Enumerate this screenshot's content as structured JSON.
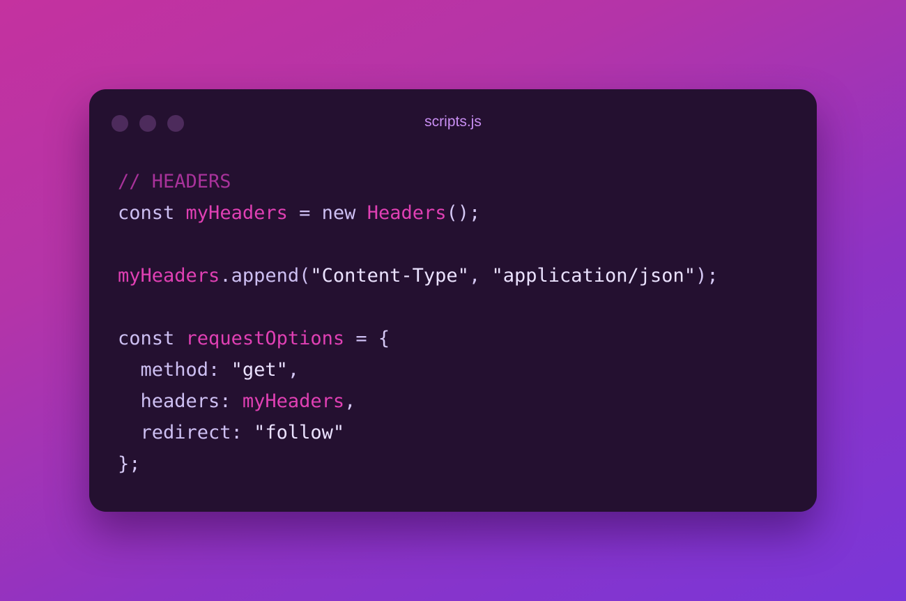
{
  "window": {
    "filename": "scripts.js"
  },
  "code": {
    "comment": "// HEADERS",
    "l2": {
      "kw": "const",
      "var": "myHeaders",
      "op": "=",
      "kw2": "new",
      "cls": "Headers",
      "tail": "();"
    },
    "l4": {
      "obj": "myHeaders",
      "method": ".append(",
      "s1": "\"Content-Type\"",
      "comma": ", ",
      "s2": "\"application/json\"",
      "tail": ");"
    },
    "l6": {
      "kw": "const",
      "var": "requestOptions",
      "op": "=",
      "brace": "{"
    },
    "l7": {
      "key": "method:",
      "val": "\"get\"",
      "tail": ","
    },
    "l8": {
      "key": "headers:",
      "val": "myHeaders",
      "tail": ","
    },
    "l9": {
      "key": "redirect:",
      "val": "\"follow\""
    },
    "l10": {
      "close": "};"
    }
  },
  "colors": {
    "background_start": "#c4329f",
    "background_end": "#7a36d8",
    "window": "#241030",
    "accent": "#e040b4"
  }
}
